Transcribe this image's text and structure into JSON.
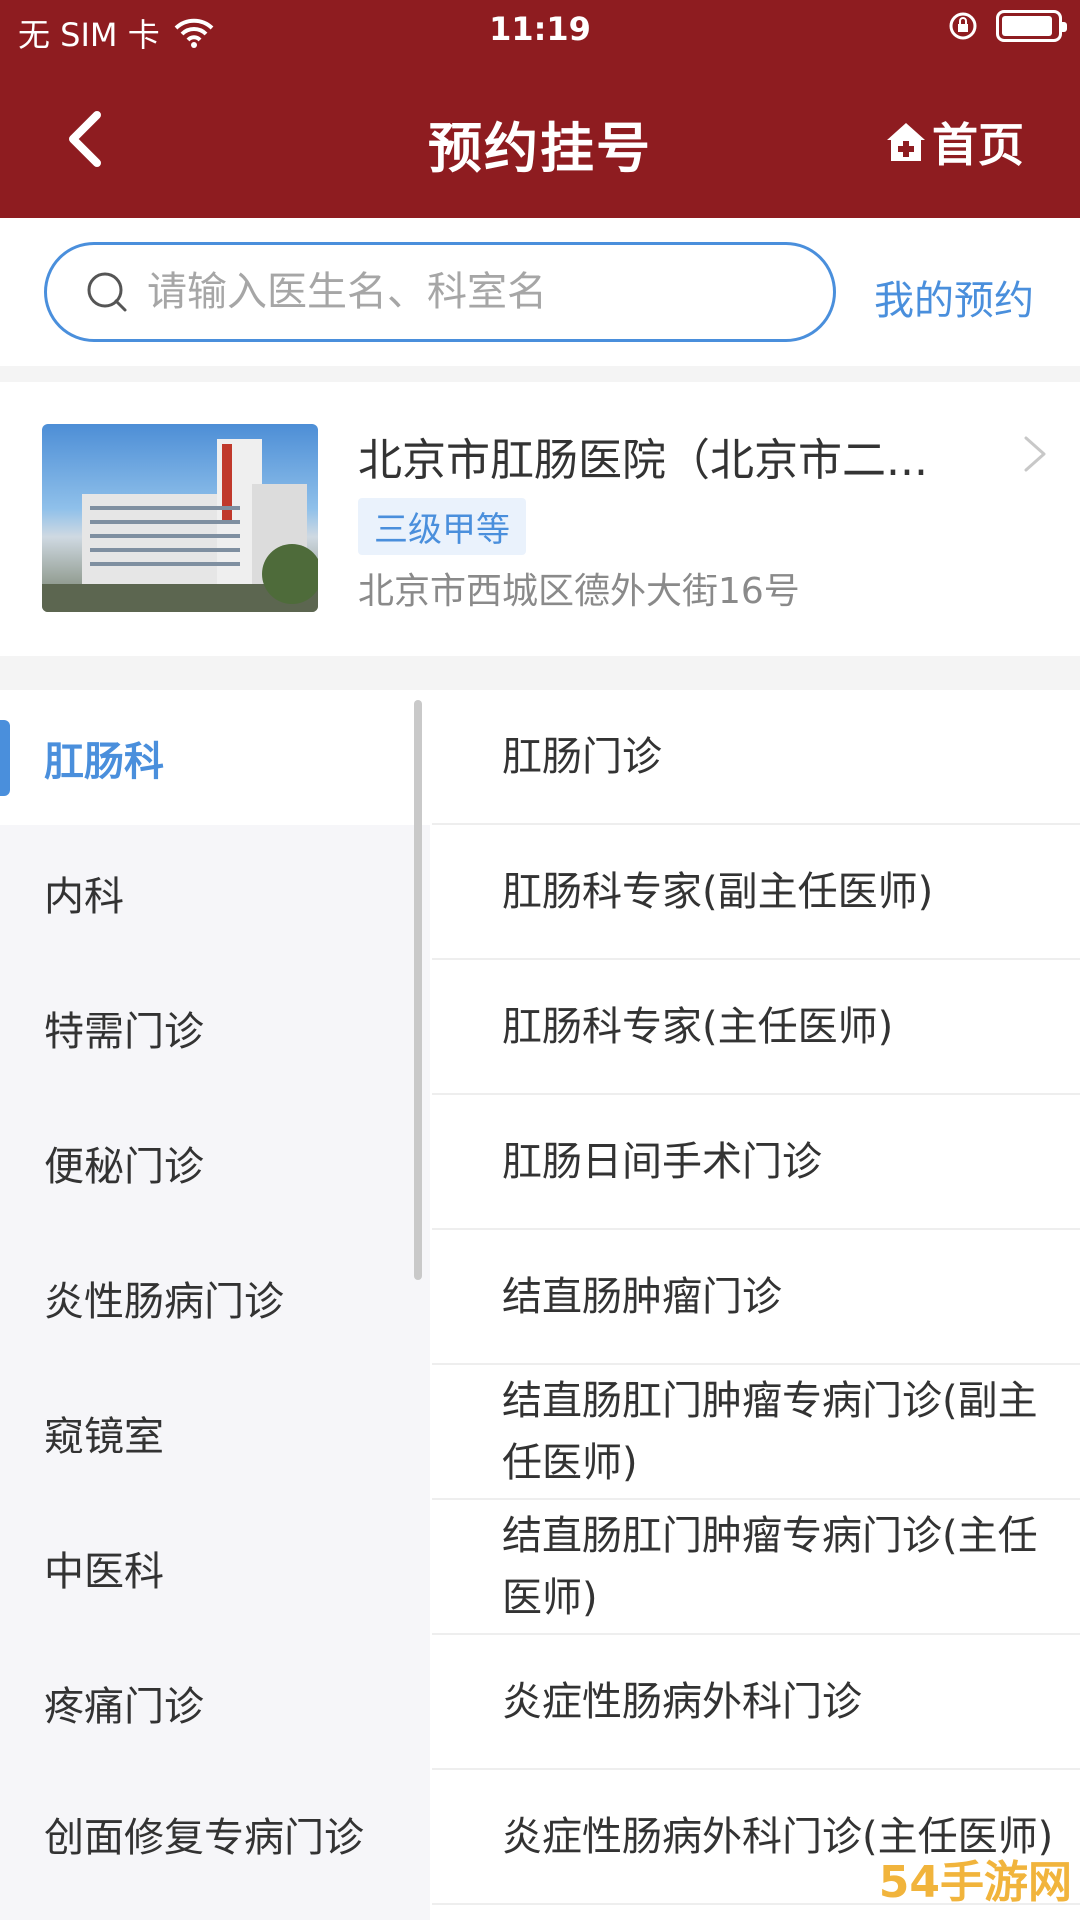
{
  "status": {
    "carrier": "无 SIM 卡",
    "time": "11:19"
  },
  "nav": {
    "title": "预约挂号",
    "home_label": "首页"
  },
  "search": {
    "placeholder": "请输入医生名、科室名",
    "my_appointments": "我的预约"
  },
  "hospital": {
    "name": "北京市肛肠医院（北京市二...",
    "level": "三级甲等",
    "address": "北京市西城区德外大街16号"
  },
  "departments": [
    {
      "label": "肛肠科"
    },
    {
      "label": "内科"
    },
    {
      "label": "特需门诊"
    },
    {
      "label": "便秘门诊"
    },
    {
      "label": "炎性肠病门诊"
    },
    {
      "label": "窥镜室"
    },
    {
      "label": "中医科"
    },
    {
      "label": "疼痛门诊"
    },
    {
      "label": "创面修复专病门诊"
    }
  ],
  "clinics": [
    {
      "label": "肛肠门诊"
    },
    {
      "label": "肛肠科专家(副主任医师)"
    },
    {
      "label": "肛肠科专家(主任医师)"
    },
    {
      "label": "肛肠日间手术门诊"
    },
    {
      "label": "结直肠肿瘤门诊"
    },
    {
      "label": "结直肠肛门肿瘤专病门诊(副主任医师)"
    },
    {
      "label": "结直肠肛门肿瘤专病门诊(主任医师)"
    },
    {
      "label": "炎症性肠病外科门诊"
    },
    {
      "label": "炎症性肠病外科门诊(主任医师)"
    }
  ],
  "watermark": "54手游网",
  "colors": {
    "header": "#8e1c20",
    "accent": "#4a8fdc"
  }
}
